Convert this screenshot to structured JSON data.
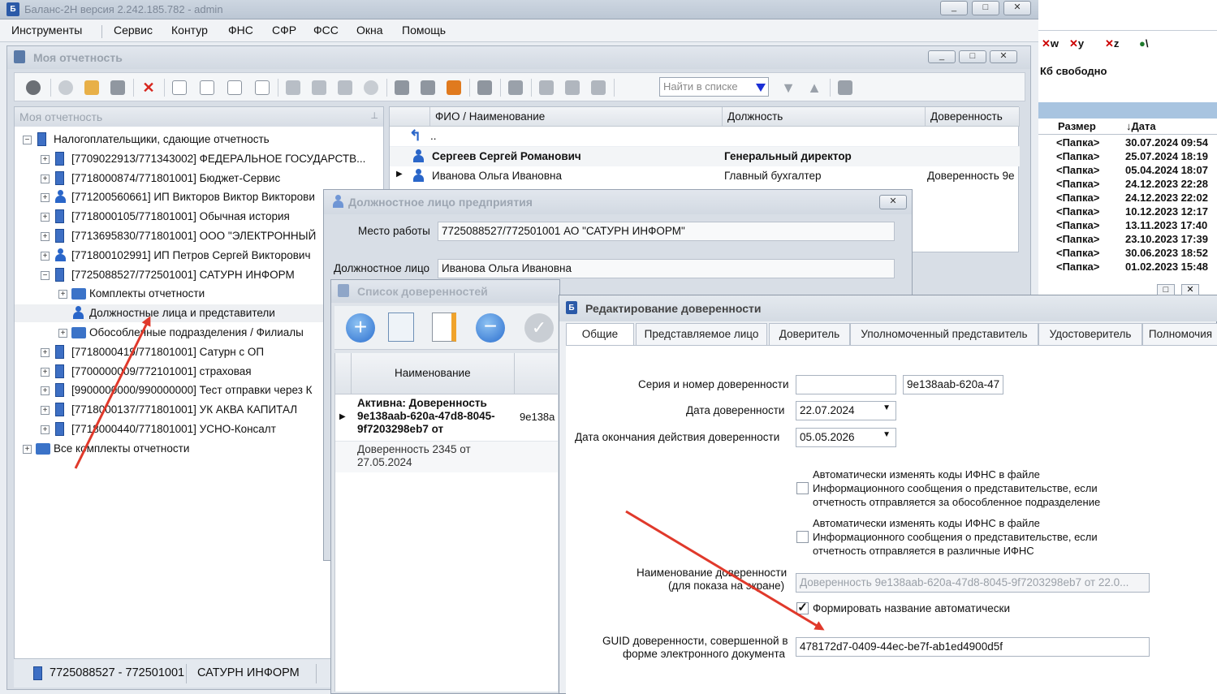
{
  "app": {
    "title": "Баланс-2Н версия 2.242.185.782 - admin",
    "min": "_",
    "max": "□",
    "close": "✕"
  },
  "menu": [
    "Инструменты",
    "Сервис",
    "Контур",
    "ФНС",
    "СФР",
    "ФСС",
    "Окна",
    "Помощь"
  ],
  "report_window": {
    "title": "Моя отчетность",
    "search_placeholder": "Найти в списке",
    "tree_title": "Моя отчетность",
    "tree": [
      {
        "label": "Налогоплательщики, сдающие отчетность"
      },
      {
        "label": "[7709022913/771343002]  ФЕДЕРАЛЬНОЕ ГОСУДАРСТВ..."
      },
      {
        "label": "[7718000874/771801001] Бюджет-Сервис"
      },
      {
        "label": "[771200560661] ИП Викторов Виктор Викторови"
      },
      {
        "label": "[7718000105/771801001] Обычная история"
      },
      {
        "label": "[7713695830/771801001] ООО \"ЭЛЕКТРОННЫЙ"
      },
      {
        "label": "[771800102991] ИП Петров Сергей Викторович"
      },
      {
        "label": "[7725088527/772501001] САТУРН ИНФОРМ"
      },
      {
        "label": "Комплекты отчетности"
      },
      {
        "label": "Должностные лица и представители"
      },
      {
        "label": "Обособленные подразделения / Филиалы"
      },
      {
        "label": "[7718000419/771801001] Сатурн с ОП"
      },
      {
        "label": "[7700000009/772101001] страховая"
      },
      {
        "label": "[9900000000/990000000] Тест отправки через К"
      },
      {
        "label": "[7718000137/771801001] УК АКВА КАПИТАЛ"
      },
      {
        "label": "[7718000440/771801001] УСНО-Консалт"
      },
      {
        "label": "Все комплекты отчетности"
      }
    ],
    "status": {
      "inn": "7725088527 - 772501001",
      "org": "САТУРН ИНФОРМ"
    },
    "grid": {
      "columns": [
        "ФИО / Наименование",
        "Должность",
        "Доверенность"
      ],
      "up": "..",
      "rows": [
        {
          "name": "Сергеев Сергей Романович",
          "position": "Генеральный директор",
          "poa": ""
        },
        {
          "name": "Иванова Ольга Ивановна",
          "position": "Главный бухгалтер",
          "poa": "Доверенность  9e"
        }
      ]
    }
  },
  "official_window": {
    "title": "Должностное лицо предприятия",
    "workplace_label": "Место работы",
    "workplace_value": "7725088527/772501001 АО \"САТУРН ИНФОРМ\"",
    "person_label": "Должностное лицо",
    "person_value": "Иванова Ольга Ивановна"
  },
  "poa_list_window": {
    "title": "Список доверенностей",
    "column": "Наименование",
    "rows": [
      {
        "text": "Активна: Доверенность 9e138aab-620a-47d8-8045-9f7203298eb7 от",
        "extra": "9e138a"
      },
      {
        "text": "Доверенность 2345  от 27.05.2024",
        "extra": ""
      }
    ]
  },
  "edit_window": {
    "title": "Редактирование доверенности",
    "tabs": [
      "Общие",
      "Представляемое лицо",
      "Доверитель",
      "Уполномоченный представитель",
      "Удостоверитель",
      "Полномочия"
    ],
    "fields": {
      "series_label": "Серия и номер доверенности",
      "series_value": "",
      "number_value": "9e138aab-620a-47",
      "date_label": "Дата доверенности",
      "date_value": "22.07.2024",
      "end_label": "Дата окончания действия доверенности",
      "end_value": "05.05.2026",
      "cb1": "Автоматически изменять коды ИФНС в файле Информационного сообщения о представительстве, если отчетность отправляется за обособленное подразделение",
      "cb2": "Автоматически изменять коды ИФНС в файле Информационного сообщения о представительстве, если отчетность отправляется в различные ИФНС",
      "name_label1": "Наименование доверенности",
      "name_label2": "(для показа на экране)",
      "name_value": "Доверенность  9e138aab-620a-47d8-8045-9f7203298eb7 от 22.0...",
      "auto_name": "Формировать название автоматически",
      "guid_label1": "GUID доверенности, совершенной в",
      "guid_label2": "форме электронного документа",
      "guid_value": "478172d7-0409-44ec-be7f-ab1ed4900d5f"
    }
  },
  "file_manager": {
    "drives": [
      "w",
      "y",
      "z",
      "\\"
    ],
    "free": "Кб свободно",
    "size_col": "Размер",
    "date_col": "↓Дата",
    "rows": [
      {
        "size": "<Папка>",
        "date": "30.07.2024 09:54"
      },
      {
        "size": "<Папка>",
        "date": "25.07.2024 18:19"
      },
      {
        "size": "<Папка>",
        "date": "05.04.2024 18:07"
      },
      {
        "size": "<Папка>",
        "date": "24.12.2023 22:28"
      },
      {
        "size": "<Папка>",
        "date": "24.12.2023 22:02"
      },
      {
        "size": "<Папка>",
        "date": "10.12.2023 12:17"
      },
      {
        "size": "<Папка>",
        "date": "13.11.2023 17:40"
      },
      {
        "size": "<Папка>",
        "date": "23.10.2023 17:39"
      },
      {
        "size": "<Папка>",
        "date": "30.06.2023 18:52"
      },
      {
        "size": "<Папка>",
        "date": "01.02.2023 15:48"
      }
    ]
  },
  "colors": {
    "arrow": "#e0392b",
    "accent": "#2b5aa8"
  }
}
